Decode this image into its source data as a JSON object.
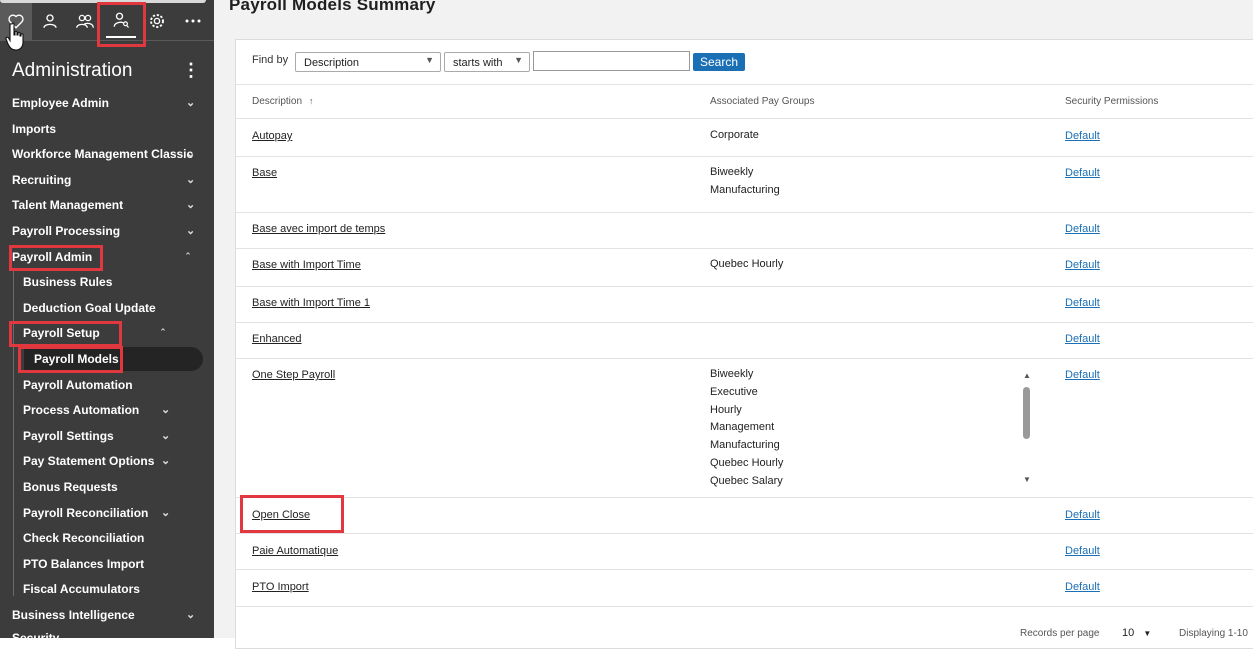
{
  "sidebar": {
    "title": "Administration",
    "top_icons": [
      "heart-icon",
      "person-icon",
      "people-icon",
      "admin-user-icon",
      "gear-icon",
      "more-icon"
    ],
    "items": [
      {
        "label": "Employee Admin",
        "expanded": false
      },
      {
        "label": "Imports"
      },
      {
        "label": "Workforce Management Classic",
        "expanded": false
      },
      {
        "label": "Recruiting",
        "expanded": false
      },
      {
        "label": "Talent Management",
        "expanded": false
      },
      {
        "label": "Payroll Processing",
        "expanded": false
      },
      {
        "label": "Payroll Admin",
        "expanded": true
      },
      {
        "label": "Business Intelligence",
        "expanded": false
      },
      {
        "label": "Security"
      }
    ],
    "payroll_admin_children": [
      {
        "label": "Business Rules"
      },
      {
        "label": "Deduction Goal Update"
      },
      {
        "label": "Payroll Setup",
        "expanded": true
      },
      {
        "label": "Payroll Models",
        "selected": true
      },
      {
        "label": "Payroll Automation"
      },
      {
        "label": "Process Automation",
        "expanded": false
      },
      {
        "label": "Payroll Settings",
        "expanded": false
      },
      {
        "label": "Pay Statement Options",
        "expanded": false
      },
      {
        "label": "Bonus Requests"
      },
      {
        "label": "Payroll Reconciliation",
        "expanded": false
      },
      {
        "label": "Check Reconciliation"
      },
      {
        "label": "PTO Balances Import"
      },
      {
        "label": "Fiscal Accumulators"
      }
    ]
  },
  "main": {
    "title": "Payroll Models Summary",
    "find_by_label": "Find by",
    "find_field": "Description",
    "find_operator": "starts with",
    "search_value": "",
    "search_button": "Search",
    "columns": {
      "description": "Description",
      "pay_groups": "Associated Pay Groups",
      "permissions": "Security Permissions"
    },
    "sort_glyph": "↑",
    "rows": [
      {
        "description": "Autopay",
        "groups": "Corporate",
        "permission": "Default"
      },
      {
        "description": "Base",
        "groups": "Biweekly\nManufacturing",
        "permission": "Default"
      },
      {
        "description": "Base avec import de temps",
        "groups": "",
        "permission": "Default"
      },
      {
        "description": "Base with Import Time",
        "groups": "Quebec Hourly",
        "permission": "Default"
      },
      {
        "description": "Base with Import Time 1",
        "groups": "",
        "permission": "Default"
      },
      {
        "description": "Enhanced",
        "groups": "",
        "permission": "Default"
      },
      {
        "description": "One Step Payroll",
        "groups": "Biweekly\nExecutive\nHourly\nManagement\nManufacturing\nQuebec Hourly\nQuebec Salary",
        "permission": "Default"
      },
      {
        "description": "Open Close",
        "groups": "",
        "permission": "Default"
      },
      {
        "description": "Paie Automatique",
        "groups": "",
        "permission": "Default"
      },
      {
        "description": "PTO Import",
        "groups": "",
        "permission": "Default"
      }
    ],
    "footer": {
      "records_label": "Records per page",
      "records_value": "10",
      "displaying": "Displaying 1-10"
    }
  },
  "colors": {
    "sidebar_bg": "#3c3c3c",
    "highlight_red": "#e0383e",
    "link_blue": "#1a6fb5"
  }
}
